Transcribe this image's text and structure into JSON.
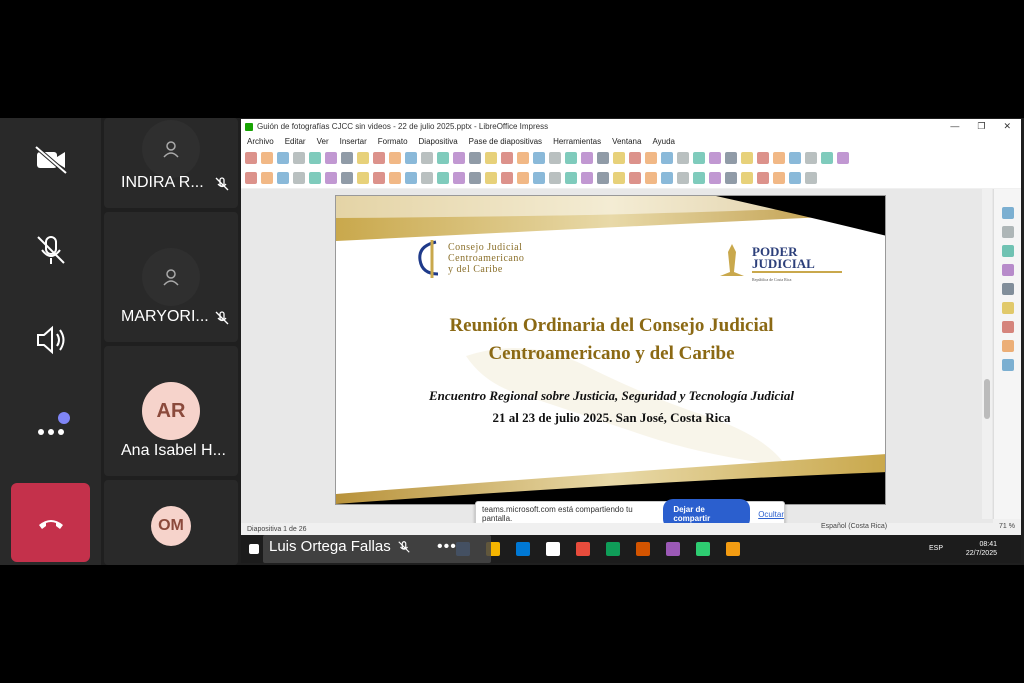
{
  "rail": {
    "camera_icon": "video-off-icon",
    "mic_icon": "mic-off-icon",
    "speaker_icon": "speaker-icon",
    "more_icon": "more-icon",
    "hangup_icon": "hangup-icon",
    "hangup_color": "#c4314b",
    "badge_color": "#7f85f5"
  },
  "participants": [
    {
      "name": "INDIRA R...",
      "initials": "",
      "muted": true
    },
    {
      "name": "MARYORI...",
      "initials": "",
      "muted": true
    },
    {
      "name": "Ana Isabel H...",
      "initials": "AR",
      "muted": false
    },
    {
      "name": "",
      "initials": "OM",
      "muted": false
    }
  ],
  "app": {
    "title": "Guión de fotografías CJCC sin videos - 22 de julio 2025.pptx - LibreOffice Impress",
    "menu": [
      "Archivo",
      "Editar",
      "Ver",
      "Insertar",
      "Formato",
      "Diapositiva",
      "Pase de diapositivas",
      "Herramientas",
      "Ventana",
      "Ayuda"
    ]
  },
  "slide": {
    "org_left": [
      "Consejo Judicial",
      "Centroamericano",
      "y del Caribe"
    ],
    "org_right": [
      "PODER",
      "JUDICIAL"
    ],
    "org_right_sub": "República de Costa Rica",
    "title_line1": "Reunión Ordinaria del Consejo Judicial",
    "title_line2": "Centroamericano y del Caribe",
    "subtitle": "Encuentro Regional sobre Justicia, Seguridad y Tecnología Judicial",
    "date_place": "21 al 23 de julio 2025.  San José, Costa Rica"
  },
  "share_bar": {
    "message": "teams.microsoft.com está compartiendo tu pantalla.",
    "stop_label": "Dejar de compartir",
    "hide_label": "Ocultar"
  },
  "status": {
    "slide_count": "Diapositiva 1 de 26",
    "language": "Español (Costa Rica)",
    "zoom": "71 %"
  },
  "taskbar": {
    "presenter": "Luis Ortega Fallas",
    "lang": "ESP",
    "time": "08:41",
    "date": "22/7/2025"
  }
}
